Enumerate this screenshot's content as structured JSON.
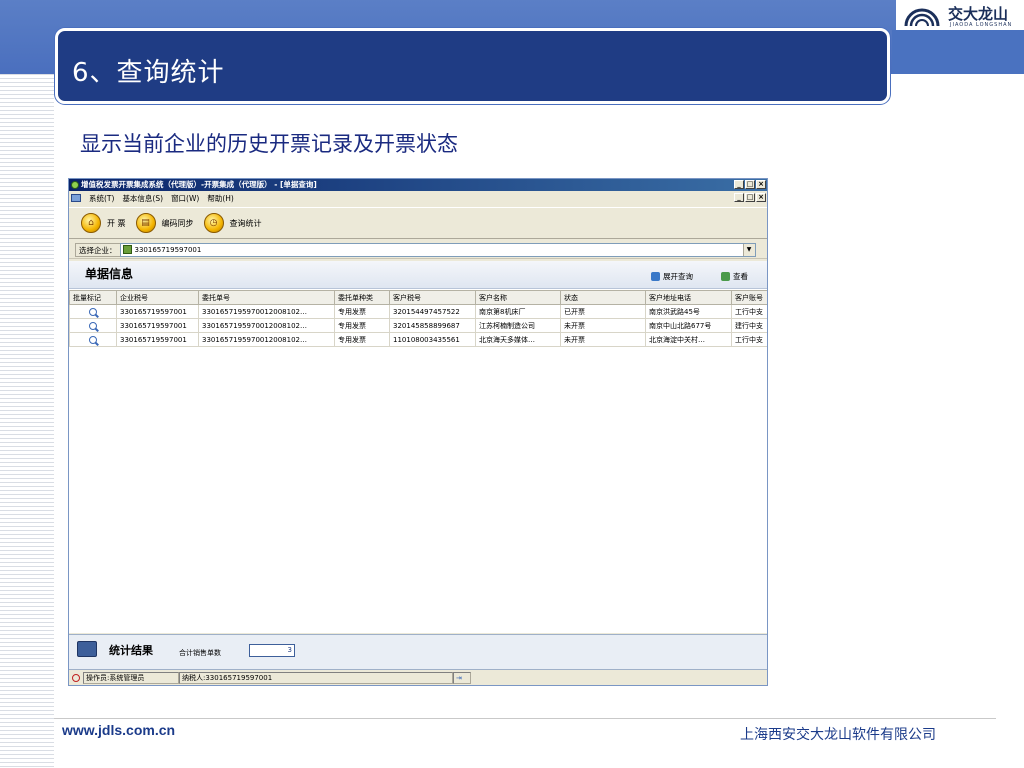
{
  "slide": {
    "title": "6、查询统计",
    "subtitle": "显示当前企业的历史开票记录及开票状态",
    "logo_cn": "交大龙山",
    "logo_en": "JIAODA LONGSHAN",
    "footer_url": "www.jdls.com.cn",
    "footer_company": "上海西安交大龙山软件有限公司"
  },
  "app": {
    "title": "增值税发票开票集成系统（代理版）-开票集成（代理版） - [单据查询]",
    "win_buttons": [
      "_",
      "□",
      "×"
    ],
    "menu": [
      "系统(T)",
      "基本信息(S)",
      "窗口(W)",
      "帮助(H)"
    ],
    "toolbar": [
      {
        "label": "开 票",
        "icon": "invoice-icon"
      },
      {
        "label": "编码同步",
        "icon": "sync-icon"
      },
      {
        "label": "查询统计",
        "icon": "query-icon"
      }
    ],
    "selector": {
      "label": "选择企业：",
      "value": "330165719597001"
    },
    "panel": {
      "title": "单据信息",
      "actions": [
        "展开查询",
        "查看"
      ]
    },
    "table": {
      "columns": [
        "批量标记",
        "企业税号",
        "委托单号",
        "委托单种类",
        "客户税号",
        "客户名称",
        "状态",
        "客户地址电话",
        "客户账号"
      ],
      "rows": [
        [
          "",
          "330165719597001",
          "3301657195970012008102…",
          "专用发票",
          "320154497457522",
          "南京第8机床厂",
          "已开票",
          "南京洪武路45号",
          "工行中支"
        ],
        [
          "",
          "330165719597001",
          "3301657195970012008102…",
          "专用发票",
          "320145858899687",
          "江苏柯楠制造公司",
          "未开票",
          "南京中山北路677号",
          "建行中支"
        ],
        [
          "",
          "330165719597001",
          "3301657195970012008102…",
          "专用发票",
          "110108003435561",
          "北京海天多媒体…",
          "未开票",
          "北京海淀中关村…",
          "工行中支"
        ]
      ]
    },
    "stats": {
      "title": "统计结果",
      "label": "合计销售单数",
      "value": "3"
    },
    "status": {
      "operator": "操作员:系统管理员",
      "taxpayer": "纳税人:330165719597001"
    }
  }
}
